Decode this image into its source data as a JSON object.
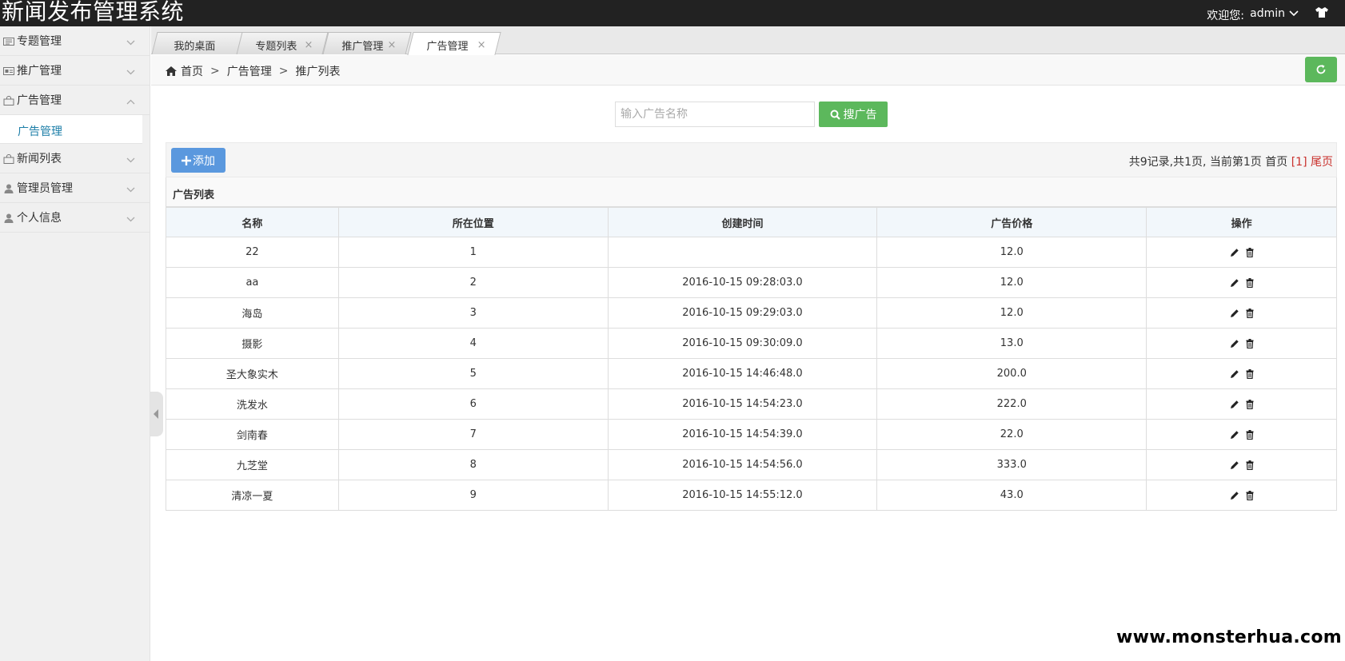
{
  "header": {
    "app_title": "新闻发布管理系统",
    "welcome": "欢迎您:",
    "username": "admin"
  },
  "sidebar": {
    "items": [
      {
        "label": "专题管理",
        "icon": "newspaper-icon",
        "expanded": false
      },
      {
        "label": "推广管理",
        "icon": "card-icon",
        "expanded": false
      },
      {
        "label": "广告管理",
        "icon": "bag-icon",
        "expanded": true
      },
      {
        "label": "新闻列表",
        "icon": "bag-icon",
        "expanded": false
      },
      {
        "label": "管理员管理",
        "icon": "user-icon",
        "expanded": false
      },
      {
        "label": "个人信息",
        "icon": "user-icon",
        "expanded": false
      }
    ],
    "subitem": "广告管理"
  },
  "tabs": [
    {
      "label": "我的桌面",
      "closable": false
    },
    {
      "label": "专题列表",
      "closable": true
    },
    {
      "label": "推广管理",
      "closable": true
    },
    {
      "label": "广告管理",
      "closable": true,
      "active": true
    }
  ],
  "tab_close_glyph": "×",
  "breadcrumb": {
    "home": "首页",
    "sep": ">",
    "level1": "广告管理",
    "level2": "推广列表"
  },
  "search": {
    "placeholder": "输入广告名称",
    "button_label": "搜广告"
  },
  "toolbar": {
    "add_label": "添加",
    "pager_text": "共9记录,共1页, 当前第1页 首页 ",
    "pager_current": "[1]",
    "pager_last": "尾页"
  },
  "table": {
    "caption": "广告列表",
    "columns": [
      "名称",
      "所在位置",
      "创建时间",
      "广告价格",
      "操作"
    ],
    "rows": [
      [
        "22",
        "1",
        "",
        "12.0"
      ],
      [
        "aa",
        "2",
        "2016-10-15 09:28:03.0",
        "12.0"
      ],
      [
        "海岛",
        "3",
        "2016-10-15 09:29:03.0",
        "12.0"
      ],
      [
        "摄影",
        "4",
        "2016-10-15 09:30:09.0",
        "13.0"
      ],
      [
        "圣大象实木",
        "5",
        "2016-10-15 14:46:48.0",
        "200.0"
      ],
      [
        "洗发水",
        "6",
        "2016-10-15 14:54:23.0",
        "222.0"
      ],
      [
        "剑南春",
        "7",
        "2016-10-15 14:54:39.0",
        "22.0"
      ],
      [
        "九芝堂",
        "8",
        "2016-10-15 14:54:56.0",
        "333.0"
      ],
      [
        "清凉一夏",
        "9",
        "2016-10-15 14:55:12.0",
        "43.0"
      ]
    ]
  },
  "colors": {
    "header_bg": "#222222",
    "primary_green": "#5cb85c",
    "add_blue": "#5a98de",
    "link_blue": "#1e7fa8",
    "pager_red": "#c9302c"
  },
  "watermark": "www.monsterhua.com"
}
